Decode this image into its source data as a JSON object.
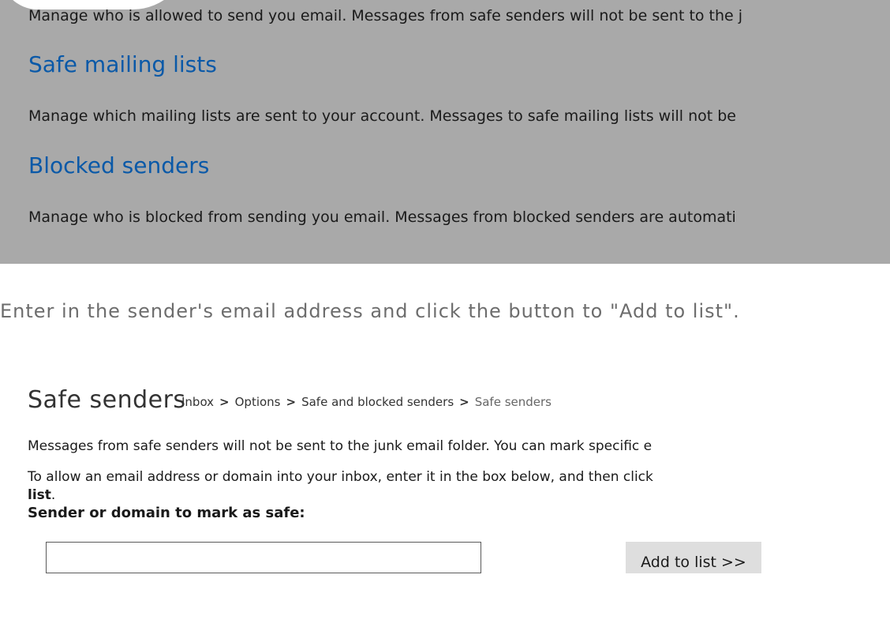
{
  "top_section": {
    "safe_senders_desc": "Manage who is allowed to send you email. Messages from safe senders will not be sent to the j",
    "mailing_lists_heading": "Safe mailing lists",
    "mailing_lists_desc": "Manage which mailing lists are sent to your account. Messages to safe mailing lists will not be",
    "blocked_heading": "Blocked senders",
    "blocked_desc": "Manage who is blocked from sending you email. Messages from blocked senders are automati"
  },
  "instruction": "Enter in the sender's email address and click the button to \"Add to list\".",
  "safe_senders_page": {
    "title": "Safe senders",
    "breadcrumb": [
      "Inbox",
      "Options",
      "Safe and blocked senders",
      "Safe senders"
    ],
    "breadcrumb_separator": ">",
    "intro": "Messages from safe senders will not be sent to the junk email folder. You can mark specific e",
    "allow_text": "To allow an email address or domain into your inbox, enter it in the box below, and then click",
    "allow_text_bold": "list",
    "allow_text_end": ".",
    "field_label": "Sender or domain to mark as safe:",
    "input_value": "",
    "add_button": "Add to list >>"
  },
  "colors": {
    "panel_bg": "#a9a9a9",
    "link_blue": "#0a59a8",
    "button_bg": "#dedede"
  }
}
